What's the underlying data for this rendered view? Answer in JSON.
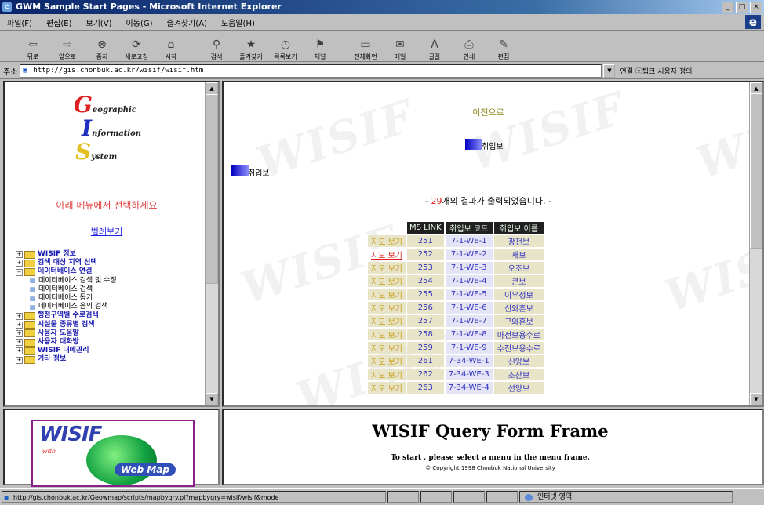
{
  "window": {
    "title": "GWM Sample Start Pages - Microsoft Internet Explorer",
    "buttons": [
      "_",
      "□",
      "×"
    ]
  },
  "menubar": {
    "items": [
      "파일(F)",
      "편집(E)",
      "보기(V)",
      "이동(G)",
      "즐겨찾기(A)",
      "도움말(H)"
    ]
  },
  "toolbar": {
    "buttons": [
      {
        "label": "뒤로",
        "icon": "back-arrow-icon",
        "glyph": "⇦"
      },
      {
        "label": "앞으로",
        "icon": "forward-arrow-icon",
        "glyph": "⇨"
      },
      {
        "label": "중지",
        "icon": "stop-icon",
        "glyph": "⊗"
      },
      {
        "label": "새로고침",
        "icon": "refresh-icon",
        "glyph": "⟳"
      },
      {
        "label": "시작",
        "icon": "home-icon",
        "glyph": "⌂"
      },
      {
        "label": "검색",
        "icon": "search-icon",
        "glyph": "⚲"
      },
      {
        "label": "즐겨찾기",
        "icon": "favorites-icon",
        "glyph": "★"
      },
      {
        "label": "목록보기",
        "icon": "history-icon",
        "glyph": "◷"
      },
      {
        "label": "채널",
        "icon": "channels-icon",
        "glyph": "⚑"
      },
      {
        "label": "전체화면",
        "icon": "fullscreen-icon",
        "glyph": "▭"
      },
      {
        "label": "메일",
        "icon": "mail-icon",
        "glyph": "✉"
      },
      {
        "label": "글꼴",
        "icon": "font-icon",
        "glyph": "A"
      },
      {
        "label": "인쇄",
        "icon": "print-icon",
        "glyph": "⎙"
      },
      {
        "label": "편집",
        "icon": "edit-icon",
        "glyph": "✎"
      }
    ]
  },
  "address": {
    "label": "주소",
    "value": "http://gis.chonbuk.ac.kr/wisif/wisif.htm",
    "links": "연결 ⓔ팁크 시용자 정의"
  },
  "menu_frame": {
    "logo": {
      "line1_cap": "G",
      "line1": "eographic",
      "line2_cap": "I",
      "line2": "nformation",
      "line3_cap": "S",
      "line3": "ystem"
    },
    "prompt": "아래 메뉴에서 선택하세요",
    "legend_link": "범례보기",
    "tree": [
      {
        "label": "WISIF 정보",
        "level": 0,
        "expander": "+"
      },
      {
        "label": "검색 대상 지역 선택",
        "level": 0,
        "expander": "+"
      },
      {
        "label": "데이터베이스 연결",
        "level": 0,
        "expander": "−"
      },
      {
        "label": "데이터베이스 검색 및 수정",
        "level": 1
      },
      {
        "label": "데이터베이스 검색",
        "level": 1
      },
      {
        "label": "데이터베이스 동기",
        "level": 1
      },
      {
        "label": "데이터베이스 음의 검색",
        "level": 1
      },
      {
        "label": "행정구역별 수로검색",
        "level": 0,
        "expander": "+"
      },
      {
        "label": "시설물 종류별 검색",
        "level": 0,
        "expander": "+"
      },
      {
        "label": "사용자 도움말",
        "level": 0,
        "expander": "+"
      },
      {
        "label": "사용자 대화방",
        "level": 0,
        "expander": "+"
      },
      {
        "label": "WISIF 내에관리",
        "level": 0,
        "expander": "+"
      },
      {
        "label": "기타 정보",
        "level": 0,
        "expander": "+"
      }
    ]
  },
  "main_frame": {
    "prev_link": "이전으로",
    "badge_mid": "취입보",
    "badge_left": "취입보",
    "result_count": "29",
    "result_msg": "개의 결과가 출력되었습니다. -",
    "result_prefix": "- ",
    "watermark": "WISIF",
    "table": {
      "headers": [
        "",
        "MS LINK",
        "취입보 코드",
        "취입보 이름"
      ],
      "rows": [
        {
          "map": "지도 보기",
          "ms": "251",
          "code": "7-1-WE-1",
          "name": "광천보",
          "selected": false
        },
        {
          "map": "지도 보기",
          "ms": "252",
          "code": "7-1-WE-2",
          "name": "새보",
          "selected": true
        },
        {
          "map": "지도 보기",
          "ms": "253",
          "code": "7-1-WE-3",
          "name": "오조보",
          "selected": false
        },
        {
          "map": "지도 보기",
          "ms": "254",
          "code": "7-1-WE-4",
          "name": "큰보",
          "selected": false
        },
        {
          "map": "지도 보기",
          "ms": "255",
          "code": "7-1-WE-5",
          "name": "이우정보",
          "selected": false
        },
        {
          "map": "지도 보기",
          "ms": "256",
          "code": "7-1-WE-6",
          "name": "신와흔보",
          "selected": false
        },
        {
          "map": "지도 보기",
          "ms": "257",
          "code": "7-1-WE-7",
          "name": "구와흔보",
          "selected": false
        },
        {
          "map": "지도 보기",
          "ms": "258",
          "code": "7-1-WE-8",
          "name": "마전보용수로",
          "selected": false
        },
        {
          "map": "지도 보기",
          "ms": "259",
          "code": "7-1-WE-9",
          "name": "수전보용수로",
          "selected": false
        },
        {
          "map": "지도 보기",
          "ms": "261",
          "code": "7-34-WE-1",
          "name": "신양보",
          "selected": false
        },
        {
          "map": "지도 보기",
          "ms": "262",
          "code": "7-34-WE-3",
          "name": "조산보",
          "selected": false
        },
        {
          "map": "지도 보기",
          "ms": "263",
          "code": "7-34-WE-4",
          "name": "선양보",
          "selected": false
        }
      ]
    }
  },
  "logo_frame": {
    "title": "WISIF",
    "with": "with",
    "badge": "Web Map"
  },
  "query_frame": {
    "title": "WISIF Query Form Frame",
    "subtitle": "To start , please select a menu in the menu frame.",
    "copyright": "© Copyright 1998 Chonbuk National University"
  },
  "status": {
    "text": "http://gis.chonbuk.ac.kr/Geowmap/scripts/mapbyqry.pl?mapbyqry=wisif/wisif&mode",
    "zone": "인터넷 영역"
  }
}
